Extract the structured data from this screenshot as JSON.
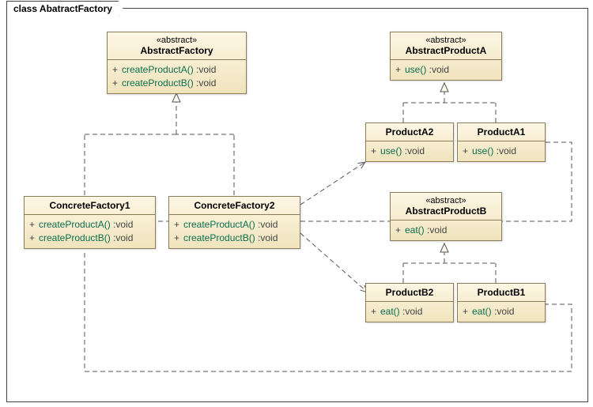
{
  "frame": {
    "title": "class AbatractFactory"
  },
  "colors": {
    "classFill": "#f5ecd0",
    "classBorder": "#8b7d5a",
    "op": "#0b6e4f"
  },
  "classes": {
    "abstractFactory": {
      "stereotype": "«abstract»",
      "name": "AbstractFactory",
      "ops": [
        {
          "vis": "+",
          "sig": "createProductA()",
          "ret": " :void"
        },
        {
          "vis": "+",
          "sig": "createProductB()",
          "ret": " :void"
        }
      ]
    },
    "concreteFactory1": {
      "name": "ConcreteFactory1",
      "ops": [
        {
          "vis": "+",
          "sig": "createProductA()",
          "ret": " :void"
        },
        {
          "vis": "+",
          "sig": "createProductB()",
          "ret": " :void"
        }
      ]
    },
    "concreteFactory2": {
      "name": "ConcreteFactory2",
      "ops": [
        {
          "vis": "+",
          "sig": "createProductA()",
          "ret": " :void"
        },
        {
          "vis": "+",
          "sig": "createProductB()",
          "ret": " :void"
        }
      ]
    },
    "abstractProductA": {
      "stereotype": "«abstract»",
      "name": "AbstractProductA",
      "ops": [
        {
          "vis": "+",
          "sig": "use()",
          "ret": " :void"
        }
      ]
    },
    "productA1": {
      "name": "ProductA1",
      "ops": [
        {
          "vis": "+",
          "sig": "use()",
          "ret": " :void"
        }
      ]
    },
    "productA2": {
      "name": "ProductA2",
      "ops": [
        {
          "vis": "+",
          "sig": "use()",
          "ret": " :void"
        }
      ]
    },
    "abstractProductB": {
      "stereotype": "«abstract»",
      "name": "AbstractProductB",
      "ops": [
        {
          "vis": "+",
          "sig": "eat()",
          "ret": " :void"
        }
      ]
    },
    "productB1": {
      "name": "ProductB1",
      "ops": [
        {
          "vis": "+",
          "sig": "eat()",
          "ret": " :void"
        }
      ]
    },
    "productB2": {
      "name": "ProductB2",
      "ops": [
        {
          "vis": "+",
          "sig": "eat()",
          "ret": " :void"
        }
      ]
    }
  },
  "relations": [
    {
      "type": "generalization",
      "from": "ConcreteFactory1",
      "to": "AbstractFactory"
    },
    {
      "type": "generalization",
      "from": "ConcreteFactory2",
      "to": "AbstractFactory"
    },
    {
      "type": "generalization",
      "from": "ProductA1",
      "to": "AbstractProductA"
    },
    {
      "type": "generalization",
      "from": "ProductA2",
      "to": "AbstractProductA"
    },
    {
      "type": "generalization",
      "from": "ProductB1",
      "to": "AbstractProductB"
    },
    {
      "type": "generalization",
      "from": "ProductB2",
      "to": "AbstractProductB"
    },
    {
      "type": "dependency",
      "from": "ConcreteFactory2",
      "to": "ProductA2"
    },
    {
      "type": "dependency",
      "from": "ConcreteFactory2",
      "to": "ProductB2"
    },
    {
      "type": "dependency",
      "from": "ConcreteFactory1",
      "to": "ProductA1"
    },
    {
      "type": "dependency",
      "from": "ConcreteFactory1",
      "to": "ProductB1"
    }
  ]
}
